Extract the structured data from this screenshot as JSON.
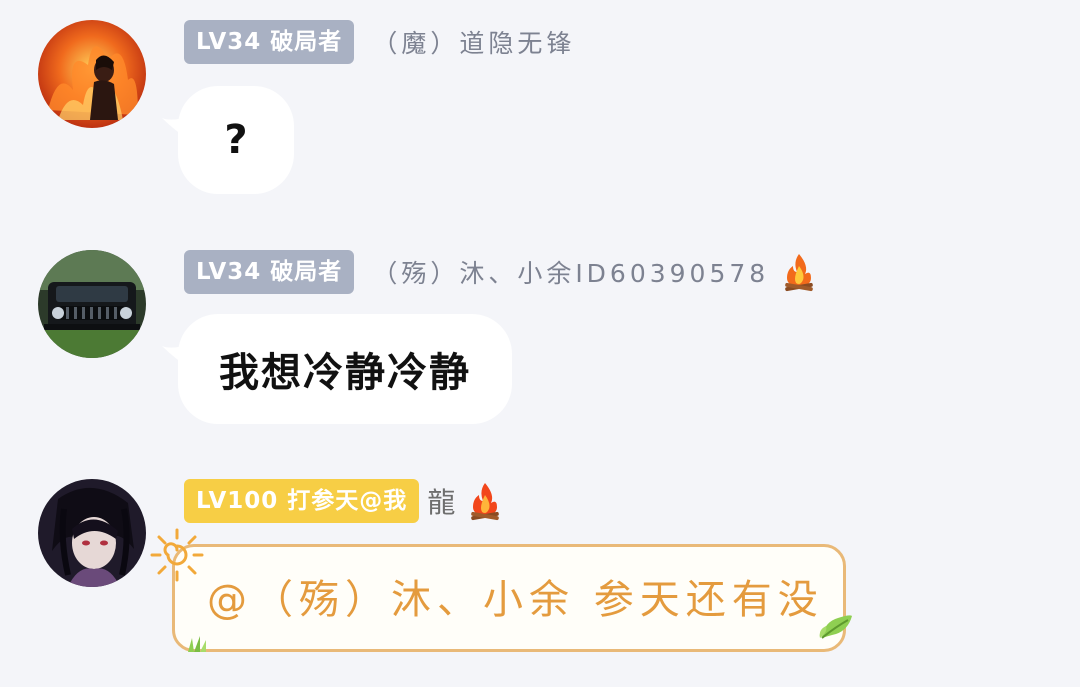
{
  "messages": [
    {
      "badge": "LV34 破局者",
      "nickname": "（魔）道隐无锋",
      "text": "?",
      "avatar": "fire-warrior-avatar",
      "badge_color": "#a9b1c3"
    },
    {
      "badge": "LV34 破局者",
      "nickname": "（殇）沐、小余ID60390578",
      "flair_icon": "campfire-icon",
      "text": "我想冷静冷静",
      "avatar": "jeep-car-avatar",
      "badge_color": "#a9b1c3"
    },
    {
      "badge": "LV100 打参天@我",
      "nickname": "龍",
      "flair_icon": "campfire-icon",
      "text": "@（殇）沐、小余 参天还有没",
      "avatar": "anime-character-avatar",
      "badge_color": "#f7ce45",
      "bubble_style": "sun-themed",
      "bubble_text_color": "#e49b3e"
    }
  ],
  "colors": {
    "background": "#f4f5f9",
    "bubble": "#ffffff"
  }
}
